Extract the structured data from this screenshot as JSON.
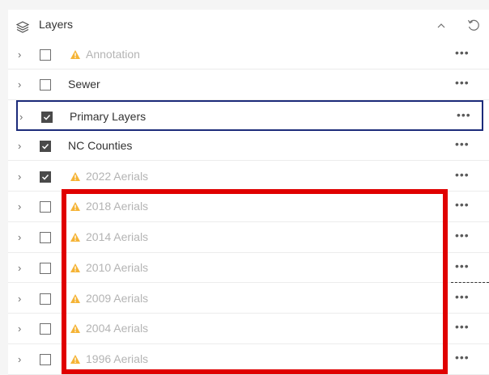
{
  "header": {
    "title": "Layers",
    "icon": "layers-icon",
    "collapse_icon": "chevron-up-icon",
    "reset_icon": "reset-icon"
  },
  "colors": {
    "warning": "#f5b335",
    "selected_border": "#1c2b7a",
    "highlight": "#e00000"
  },
  "layers": [
    {
      "label": "Annotation",
      "checked": false,
      "warning": true,
      "dimmed": true,
      "selected": false
    },
    {
      "label": "Sewer",
      "checked": false,
      "warning": false,
      "dimmed": false,
      "selected": false
    },
    {
      "label": "Primary Layers",
      "checked": true,
      "warning": false,
      "dimmed": false,
      "selected": true
    },
    {
      "label": "NC Counties",
      "checked": true,
      "warning": false,
      "dimmed": false,
      "selected": false
    },
    {
      "label": "2022 Aerials",
      "checked": true,
      "warning": true,
      "dimmed": true,
      "selected": false
    },
    {
      "label": "2018 Aerials",
      "checked": false,
      "warning": true,
      "dimmed": true,
      "selected": false
    },
    {
      "label": "2014 Aerials",
      "checked": false,
      "warning": true,
      "dimmed": true,
      "selected": false
    },
    {
      "label": "2010 Aerials",
      "checked": false,
      "warning": true,
      "dimmed": true,
      "selected": false
    },
    {
      "label": "2009 Aerials",
      "checked": false,
      "warning": true,
      "dimmed": true,
      "selected": false
    },
    {
      "label": "2004 Aerials",
      "checked": false,
      "warning": true,
      "dimmed": true,
      "selected": false
    },
    {
      "label": "1996 Aerials",
      "checked": false,
      "warning": true,
      "dimmed": true,
      "selected": false
    }
  ],
  "row_controls": {
    "expand_glyph": "›",
    "more_glyph": "•••"
  }
}
